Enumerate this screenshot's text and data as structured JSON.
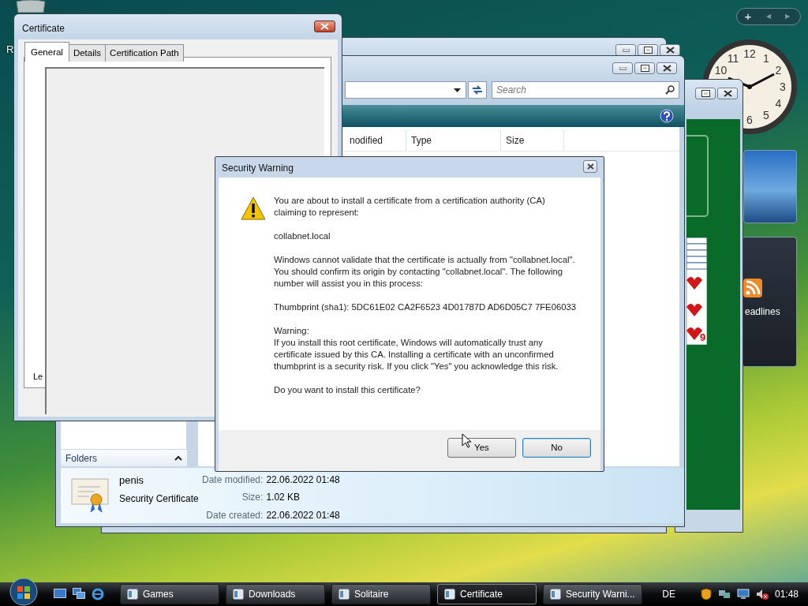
{
  "desktop": {
    "icon_label": "R"
  },
  "gadgets": {
    "toolbar": {
      "add": "+",
      "prev": "◀",
      "next": "▶"
    },
    "clock": {
      "numerals": [
        "10",
        "11",
        "12",
        "1",
        "2",
        "3",
        "4",
        "5",
        "6"
      ]
    },
    "feed": {
      "label": "eadlines"
    }
  },
  "explorer": {
    "search": {
      "placeholder": "Search"
    },
    "columns": [
      "nodified",
      "Type",
      "Size"
    ],
    "nav": {
      "label": "Folders",
      "expanded": true
    },
    "details": {
      "name": "penis",
      "type": "Security Certificate",
      "properties": [
        {
          "label": "Date modified:",
          "value": "22.06.2022 01:48"
        },
        {
          "label": "Size:",
          "value": "1.02 KB"
        },
        {
          "label": "Date created:",
          "value": "22.06.2022 01:48"
        }
      ]
    }
  },
  "solitaire": {
    "card_rank": "9"
  },
  "certificate": {
    "title": "Certificate",
    "tabs": [
      {
        "label": "General",
        "selected": true
      },
      {
        "label": "Details",
        "selected": false
      },
      {
        "label": "Certification Path",
        "selected": false
      }
    ],
    "partial_text": "Le"
  },
  "security_warning": {
    "title": "Security Warning",
    "paragraphs": [
      {
        "kind": "para",
        "text": "You are about to install a certificate from a certification authority (CA) claiming to represent:"
      },
      {
        "kind": "para",
        "text": "collabnet.local"
      },
      {
        "kind": "para",
        "text": "Windows cannot validate that the certificate is actually from \"collabnet.local\". You should confirm its origin by contacting \"collabnet.local\". The following number will assist you in this process:"
      },
      {
        "kind": "para",
        "text": "Thumbprint (sha1): 5DC61E02 CA2F6523 4D01787D AD6D05C7 7FE06033"
      },
      {
        "kind": "heading",
        "text": "Warning:"
      },
      {
        "kind": "para",
        "text": "If you install this root certificate, Windows will automatically trust any certificate issued by this CA. Installing a certificate with an unconfirmed thumbprint is a security risk. If you click \"Yes\" you acknowledge this risk."
      },
      {
        "kind": "para",
        "text": "Do you want to install this certificate?"
      }
    ],
    "buttons": [
      {
        "label": "Yes",
        "selected": false
      },
      {
        "label": "No",
        "selected": true
      }
    ]
  },
  "taskbar": {
    "tasks": [
      {
        "label": "Games",
        "selected": false
      },
      {
        "label": "Downloads",
        "selected": false
      },
      {
        "label": "Solitaire",
        "selected": false
      },
      {
        "label": "Certificate",
        "selected": true
      },
      {
        "label": "Security Warni...",
        "selected": false
      }
    ],
    "language": "DE",
    "time": "01:48"
  }
}
